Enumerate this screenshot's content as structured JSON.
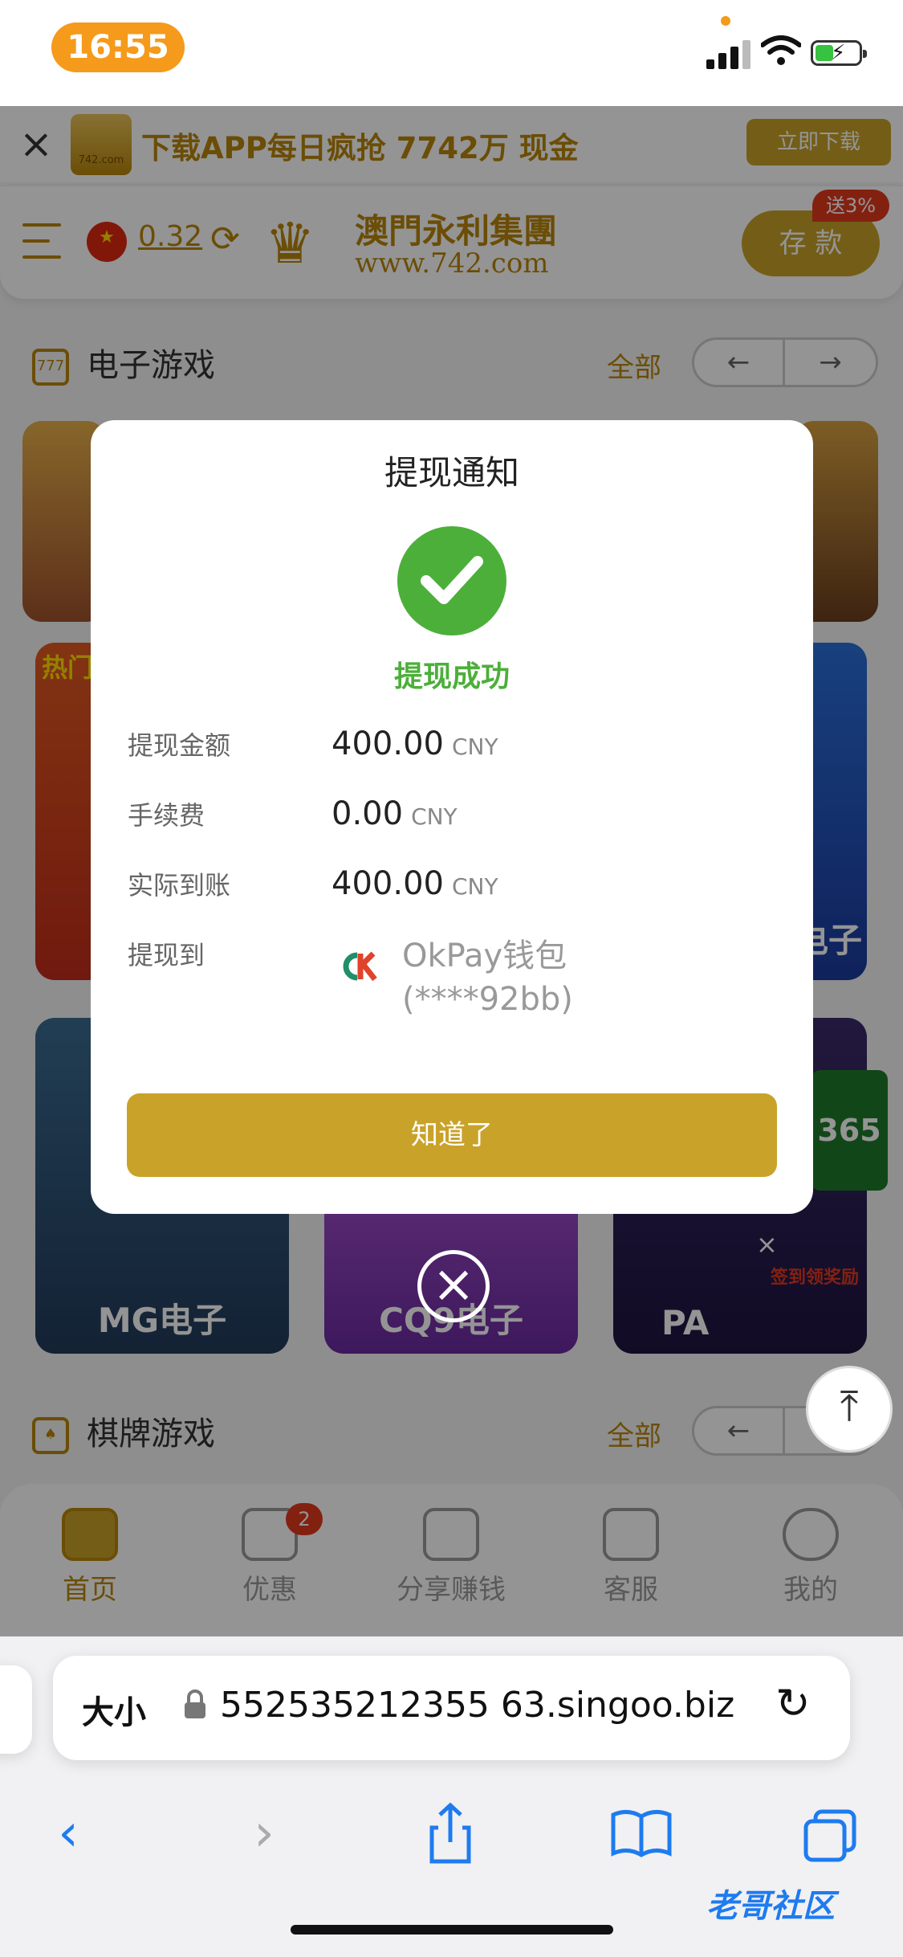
{
  "status_bar": {
    "time": "16:55"
  },
  "banner": {
    "ad_text": "下载APP每日疯抢 7742万 现金",
    "download_label": "立即下载",
    "logo_text": "742.com"
  },
  "header": {
    "balance": "0.32",
    "brand_name": "澳門永利集團",
    "brand_url": "www.742.com",
    "deposit_label": "存 款",
    "deposit_badge": "送3%"
  },
  "sections": [
    {
      "title": "电子游戏",
      "all_label": "全部",
      "prev": "←",
      "next": "→"
    },
    {
      "title": "棋牌游戏",
      "all_label": "全部",
      "prev": "←",
      "next": "→"
    }
  ],
  "tiles": [
    {
      "label": "MG电子"
    },
    {
      "label": "CQ9电子"
    },
    {
      "label": "PA"
    },
    {
      "label": "电子"
    },
    {
      "label": "热门"
    },
    {
      "label": "签到领奖励"
    },
    {
      "label": "365"
    }
  ],
  "bottom_nav": [
    {
      "label": "首页",
      "icon": "home-icon",
      "active": true
    },
    {
      "label": "优惠",
      "icon": "gift-icon",
      "badge": "2"
    },
    {
      "label": "分享赚钱",
      "icon": "share-icon"
    },
    {
      "label": "客服",
      "icon": "headset-icon"
    },
    {
      "label": "我的",
      "icon": "user-icon"
    }
  ],
  "modal": {
    "title": "提现通知",
    "status": "提现成功",
    "rows": [
      {
        "key": "提现金额",
        "value": "400.00",
        "unit": "CNY"
      },
      {
        "key": "手续费",
        "value": "0.00",
        "unit": "CNY"
      },
      {
        "key": "实际到账",
        "value": "400.00",
        "unit": "CNY"
      }
    ],
    "dest_key": "提现到",
    "dest_name": "OkPay钱包",
    "dest_account": "(****92bb)",
    "confirm_label": "知道了"
  },
  "browser": {
    "size_label": "大小",
    "url": "552535212355 63.singoo.biz"
  },
  "watermark": "老哥社区",
  "colors": {
    "gold": "#c9a229",
    "success_green": "#4caf3a",
    "ios_blue": "#1e7bf0",
    "status_orange": "#f59a1b"
  }
}
